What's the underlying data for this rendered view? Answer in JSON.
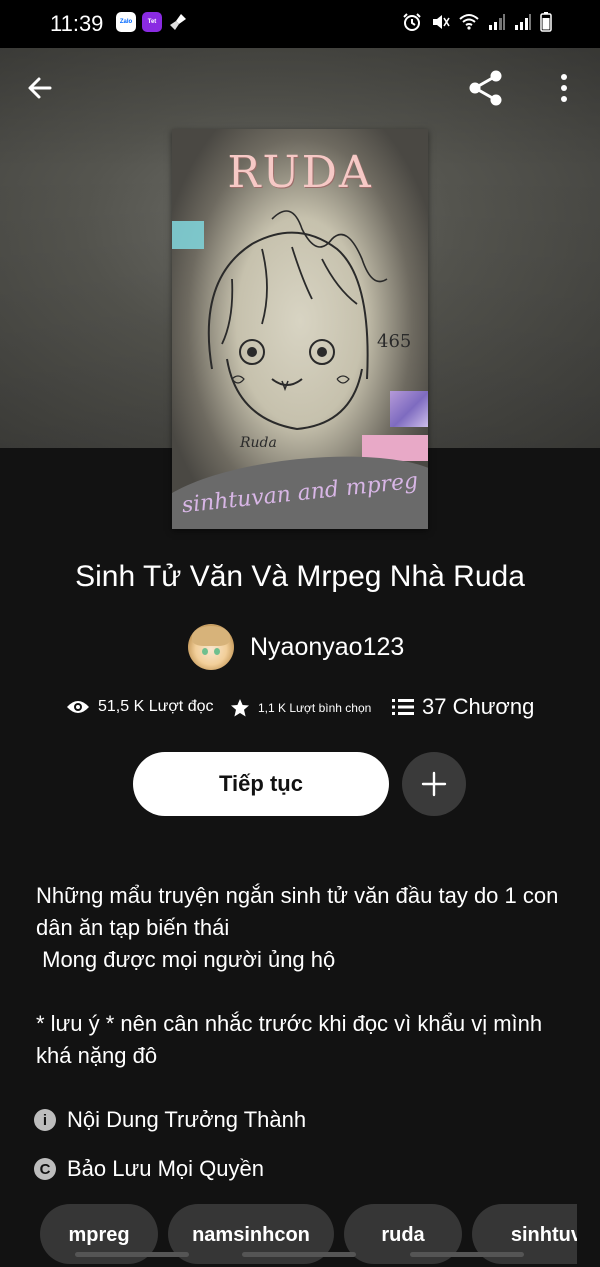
{
  "status_bar": {
    "time": "11:39",
    "app_icons": [
      "zalo-icon",
      "lixi-icon",
      "cleaner-icon"
    ],
    "right_icons": [
      "alarm-icon",
      "mute-icon",
      "wifi-icon",
      "signal-icon",
      "signal-icon",
      "battery-icon"
    ],
    "zalo_label": "Zalo",
    "tet_label": "Tet"
  },
  "header": {
    "back_icon": "arrow-left-icon",
    "share_icon": "share-icon",
    "more_icon": "more-vertical-icon"
  },
  "cover": {
    "title_text": "RUDA",
    "banner_text": "sinhtuvan and mpreg",
    "sketch_signature": "Ruda",
    "sketch_number": "465"
  },
  "book": {
    "title": "Sinh Tử Văn Và Mrpeg Nhà Ruda",
    "author": "Nyaonyao123"
  },
  "stats": {
    "reads": "51,5 K Lượt đọc",
    "votes": "1,1 K Lượt bình chọn",
    "chapters": "37 Chương"
  },
  "actions": {
    "continue_label": "Tiếp tục",
    "add_symbol": "+"
  },
  "description": "Những mẩu truyện ngắn sinh tử văn đầu tay do 1 con dân ăn tạp biến thái\n Mong được mọi người ủng hộ\n\n* lưu ý * nên cân nhắc trước khi đọc vì khẩu vị mình khá nặng đô",
  "info": {
    "mature_label": "Nội Dung Trưởng Thành",
    "mature_icon_glyph": "i",
    "copyright_label": "Bảo Lưu Mọi Quyền",
    "copyright_icon_glyph": "C"
  },
  "tags": [
    "mpreg",
    "namsinhcon",
    "ruda",
    "sinhtuva"
  ],
  "colors": {
    "background": "#121212",
    "button_primary": "#ffffff",
    "button_secondary": "#3a3a3a",
    "tag_background": "#363636",
    "cover_title": "#f6c9c6",
    "cover_banner_text": "#d8b6e6"
  }
}
